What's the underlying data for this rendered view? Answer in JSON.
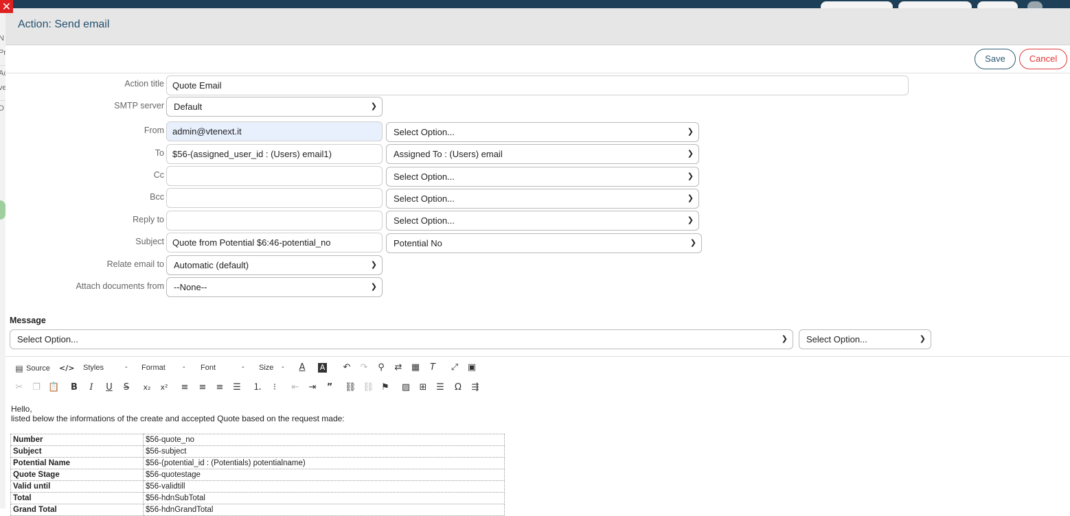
{
  "dialog": {
    "title": "Action: Send email",
    "save_label": "Save",
    "cancel_label": "Cancel"
  },
  "background_labels": [
    "N",
    "Pr",
    "Ac",
    "ve",
    "D"
  ],
  "form": {
    "action_title": {
      "label": "Action title",
      "value": "Quote Email"
    },
    "smtp_server": {
      "label": "SMTP server",
      "value": "Default"
    },
    "from": {
      "label": "From",
      "value": "admin@vtenext.it",
      "option": "Select Option..."
    },
    "to": {
      "label": "To",
      "value": "$56-(assigned_user_id : (Users) email1)",
      "option": "Assigned To : (Users) email"
    },
    "cc": {
      "label": "Cc",
      "value": "",
      "option": "Select Option..."
    },
    "bcc": {
      "label": "Bcc",
      "value": "",
      "option": "Select Option..."
    },
    "reply_to": {
      "label": "Reply to",
      "value": "",
      "option": "Select Option..."
    },
    "subject": {
      "label": "Subject",
      "value": "Quote from Potential $6:46-potential_no",
      "option": "Potential No"
    },
    "relate_email_to": {
      "label": "Relate email to",
      "value": "Automatic (default)"
    },
    "attach_documents_from": {
      "label": "Attach documents from",
      "value": "--None--"
    }
  },
  "message": {
    "label": "Message",
    "option1": "Select Option...",
    "option2": "Select Option..."
  },
  "toolbar": {
    "source": "Source",
    "styles": "Styles",
    "format": "Format",
    "font": "Font",
    "size": "Size"
  },
  "editor": {
    "greeting": "Hello,",
    "intro": "listed below the informations of the create and accepted Quote based on the request made:",
    "rows": [
      {
        "key": "Number",
        "value": "$56-quote_no"
      },
      {
        "key": "Subject",
        "value": "$56-subject"
      },
      {
        "key": "Potential Name",
        "value": "$56-(potential_id : (Potentials) potentialname)"
      },
      {
        "key": "Quote Stage",
        "value": "$56-quotestage"
      },
      {
        "key": "Valid until",
        "value": "$56-validtill"
      },
      {
        "key": "Total",
        "value": "$56-hdnSubTotal"
      },
      {
        "key": "Grand Total",
        "value": "$56-hdnGrandTotal"
      }
    ]
  },
  "colors": {
    "accent": "#24506e",
    "cancel": "#e23434",
    "header_bg": "#e6e6e6",
    "autofill_bg": "#e8f0fe"
  }
}
